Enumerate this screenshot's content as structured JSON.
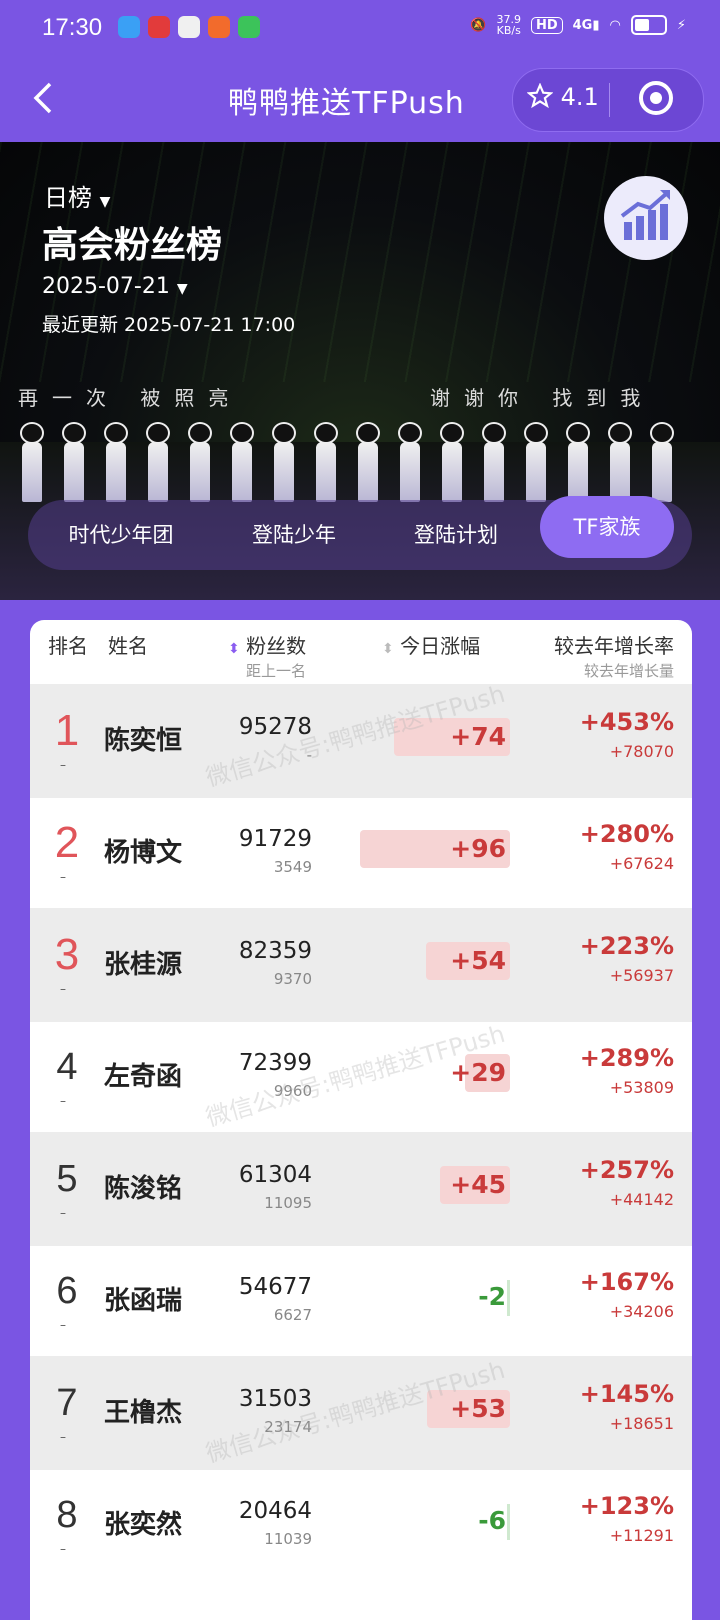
{
  "status_bar": {
    "time": "17:30",
    "net_speed_value": "37.9",
    "net_speed_unit": "KB/s",
    "hd": "HD",
    "signal": "4G"
  },
  "nav": {
    "back_icon": "chevron-left-icon",
    "title": "鸭鸭推送TFPush",
    "rating": "4.1",
    "star_icon": "star-outline-icon",
    "target_icon": "target-circle-icon"
  },
  "banner": {
    "period_label": "日榜",
    "ranking_name": "高会粉丝榜",
    "date": "2025-07-21",
    "last_updated": "最近更新 2025-07-21 17:00",
    "lyric_left": "再一次 被照亮",
    "lyric_right": "谢谢你 找到我",
    "chart_icon": "trend-chart-icon"
  },
  "tabs": [
    {
      "label": "时代少年团",
      "active": false
    },
    {
      "label": "登陆少年",
      "active": false
    },
    {
      "label": "登陆计划",
      "active": false
    },
    {
      "label": "TF家族",
      "active": true
    }
  ],
  "table": {
    "headers": {
      "rank": "排名",
      "name": "姓名",
      "fans": "粉丝数",
      "fans_sub": "距上一名",
      "today": "今日涨幅",
      "yoy": "较去年增长率",
      "yoy_sub": "较去年增长量"
    },
    "watermark": "微信公众号:鸭鸭推送TFPush",
    "rows": [
      {
        "rank": "1",
        "name": "陈奕恒",
        "fans": "95278",
        "gap": "-",
        "today": "+74",
        "today_value": 74,
        "yoy": "+453%",
        "yoy_abs": "+78070"
      },
      {
        "rank": "2",
        "name": "杨博文",
        "fans": "91729",
        "gap": "3549",
        "today": "+96",
        "today_value": 96,
        "yoy": "+280%",
        "yoy_abs": "+67624"
      },
      {
        "rank": "3",
        "name": "张桂源",
        "fans": "82359",
        "gap": "9370",
        "today": "+54",
        "today_value": 54,
        "yoy": "+223%",
        "yoy_abs": "+56937"
      },
      {
        "rank": "4",
        "name": "左奇函",
        "fans": "72399",
        "gap": "9960",
        "today": "+29",
        "today_value": 29,
        "yoy": "+289%",
        "yoy_abs": "+53809"
      },
      {
        "rank": "5",
        "name": "陈浚铭",
        "fans": "61304",
        "gap": "11095",
        "today": "+45",
        "today_value": 45,
        "yoy": "+257%",
        "yoy_abs": "+44142"
      },
      {
        "rank": "6",
        "name": "张函瑞",
        "fans": "54677",
        "gap": "6627",
        "today": "-2",
        "today_value": -2,
        "yoy": "+167%",
        "yoy_abs": "+34206"
      },
      {
        "rank": "7",
        "name": "王橹杰",
        "fans": "31503",
        "gap": "23174",
        "today": "+53",
        "today_value": 53,
        "yoy": "+145%",
        "yoy_abs": "+18651"
      },
      {
        "rank": "8",
        "name": "张奕然",
        "fans": "20464",
        "gap": "11039",
        "today": "-6",
        "today_value": -6,
        "yoy": "+123%",
        "yoy_abs": "+11291"
      }
    ]
  },
  "colors": {
    "brand_purple": "#7a55e3",
    "tab_active": "#8e6cf2",
    "positive": "#c93a3a",
    "negative": "#3a9a3a",
    "top_rank": "#e0555a"
  }
}
